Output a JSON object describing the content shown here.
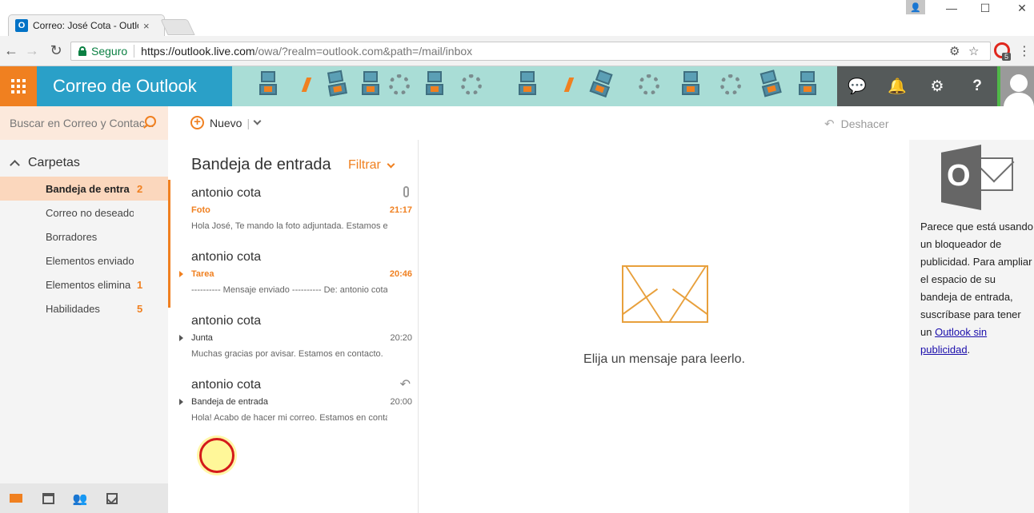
{
  "browser": {
    "tab_title": "Correo: José Cota - Outlo",
    "tab_close": "×",
    "secure_label": "Seguro",
    "url_host": "https://outlook.live.com",
    "url_path": "/owa/?realm=outlook.com&path=/mail/inbox",
    "win_minimize": "—",
    "win_maximize": "☐",
    "win_close": "✕",
    "ext_badge": "5"
  },
  "header": {
    "brand": "Correo de Outlook",
    "accent_color": "#f08020",
    "brand_color": "#2aa0c8"
  },
  "sidebar": {
    "search_placeholder": "Buscar en Correo y Contac...",
    "folders_label": "Carpetas",
    "folders": [
      {
        "name": "Bandeja de entra",
        "count": "2"
      },
      {
        "name": "Correo no deseado",
        "count": ""
      },
      {
        "name": "Borradores",
        "count": ""
      },
      {
        "name": "Elementos enviados",
        "count": ""
      },
      {
        "name": "Elementos elimina",
        "count": "1"
      },
      {
        "name": "Habilidades",
        "count": "5"
      }
    ]
  },
  "commands": {
    "new_label": "Nuevo",
    "undo_label": "Deshacer"
  },
  "inbox": {
    "title": "Bandeja de entrada",
    "filter_label": "Filtrar",
    "messages": [
      {
        "from": "antonio cota",
        "subject": "Foto",
        "time": "21:17",
        "preview": "Hola José, Te mando la foto adjuntada. Estamos en contacto.",
        "unread": true,
        "attachment": true
      },
      {
        "from": "antonio cota",
        "subject": "Tarea",
        "time": "20:46",
        "preview": "---------- Mensaje enviado ---------- De: antonio cota",
        "unread": true
      },
      {
        "from": "antonio cota",
        "subject": "Junta",
        "time": "20:20",
        "preview": "Muchas gracias por avisar. Estamos en contacto.",
        "unread": false
      },
      {
        "from": "antonio cota",
        "subject": "Bandeja de entrada",
        "time": "20:00",
        "preview": "Hola! Acabo de hacer mi correo. Estamos en contacto.",
        "unread": false,
        "replied": true
      }
    ]
  },
  "reading": {
    "empty_text": "Elija un mensaje para leerlo."
  },
  "ad": {
    "logo_letter": "O",
    "text": "Parece que está usando un bloqueador de publicidad. Para ampliar el espacio de su bandeja de entrada, suscríbase para tener un ",
    "link": "Outlook sin publicidad",
    "after": "."
  }
}
